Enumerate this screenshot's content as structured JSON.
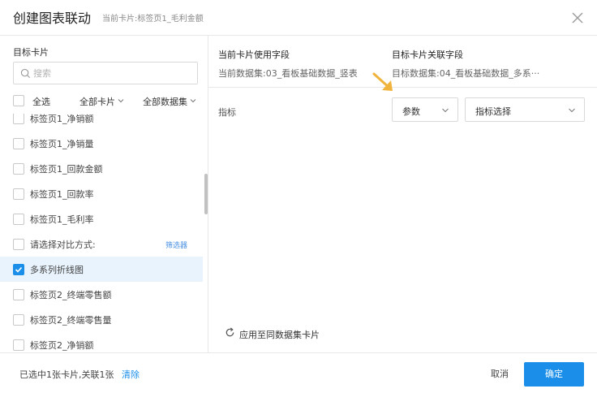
{
  "header": {
    "title": "创建图表联动",
    "subtitle": "当前卡片:标签页1_毛利金额"
  },
  "left": {
    "panel_label": "目标卡片",
    "search_placeholder": "搜索",
    "select_all": "全选",
    "filter_cards": "全部卡片",
    "filter_datasets": "全部数据集",
    "items": [
      {
        "label": "标签页1_净销额",
        "checked": false
      },
      {
        "label": "标签页1_净销量",
        "checked": false
      },
      {
        "label": "标签页1_回款金额",
        "checked": false
      },
      {
        "label": "标签页1_回款率",
        "checked": false
      },
      {
        "label": "标签页1_毛利率",
        "checked": false
      },
      {
        "label": "请选择对比方式:",
        "checked": false,
        "tag": "筛选器"
      },
      {
        "label": "多系列折线图",
        "checked": true
      },
      {
        "label": "标签页2_终端零售额",
        "checked": false
      },
      {
        "label": "标签页2_终端零售量",
        "checked": false
      },
      {
        "label": "标签页2_净销额",
        "checked": false
      }
    ]
  },
  "right": {
    "current_field_header": "当前卡片使用字段",
    "current_field_value": "当前数据集:03_看板基础数据_竖表",
    "target_field_header": "目标卡片关联字段",
    "target_field_value": "目标数据集:04_看板基础数据_多系···",
    "metric_label": "指标",
    "param_select": "参数",
    "metric_select": "指标选择",
    "apply_same_dataset": "应用至同数据集卡片"
  },
  "footer": {
    "info": "已选中1张卡片,关联1张",
    "clear": "清除",
    "cancel": "取消",
    "ok": "确定"
  },
  "colors": {
    "accent": "#1a8ee8",
    "selected_row": "#e8f3fd",
    "arrow": "#f0b43c"
  }
}
